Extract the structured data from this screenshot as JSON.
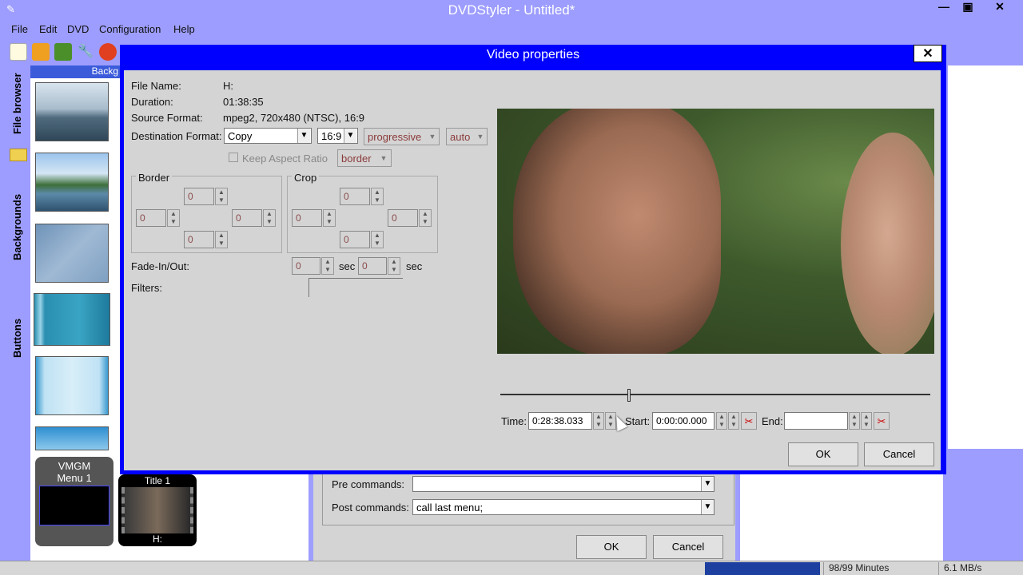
{
  "app": {
    "title": "DVDStyler - Untitled*",
    "menu": [
      "File",
      "Edit",
      "DVD",
      "Configuration",
      "Help"
    ],
    "side_tabs": [
      "File browser",
      "Backgrounds",
      "Buttons"
    ],
    "thumb_header": "Backg"
  },
  "menus_panel": {
    "vmgm_label": "VMGM",
    "menu1_label": "Menu 1",
    "title1_label": "Title 1",
    "title1_file": "H:"
  },
  "status": {
    "minutes": "98/99 Minutes",
    "speed": "6.1 MB/s"
  },
  "bg_dialog": {
    "pre_label": "Pre commands:",
    "pre_value": "",
    "post_label": "Post commands:",
    "post_value": "call last menu;",
    "ok": "OK",
    "cancel": "Cancel"
  },
  "video_dialog": {
    "title": "Video properties",
    "file_name_label": "File Name:",
    "file_name_value": "H:",
    "duration_label": "Duration:",
    "duration_value": "01:38:35",
    "source_label": "Source Format:",
    "source_value": "mpeg2, 720x480 (NTSC), 16:9",
    "dest_label": "Destination Format:",
    "dest_format": "Copy",
    "aspect": "16:9",
    "scan": "progressive",
    "auto": "auto",
    "keep_aspect_label": "Keep Aspect Ratio",
    "keep_aspect_mode": "border",
    "border_label": "Border",
    "crop_label": "Crop",
    "border_values": {
      "top": "0",
      "left": "0",
      "right": "0",
      "bottom": "0"
    },
    "crop_values": {
      "top": "0",
      "left": "0",
      "right": "0",
      "bottom": "0"
    },
    "fade_label": "Fade-In/Out:",
    "fade_in": "0",
    "fade_out": "0",
    "sec": "sec",
    "filters_label": "Filters:",
    "time_label": "Time:",
    "time_value": "0:28:38.033",
    "start_label": "Start:",
    "start_value": "0:00:00.000",
    "end_label": "End:",
    "end_value": "",
    "ok": "OK",
    "cancel": "Cancel",
    "slider_position": 0.3
  }
}
